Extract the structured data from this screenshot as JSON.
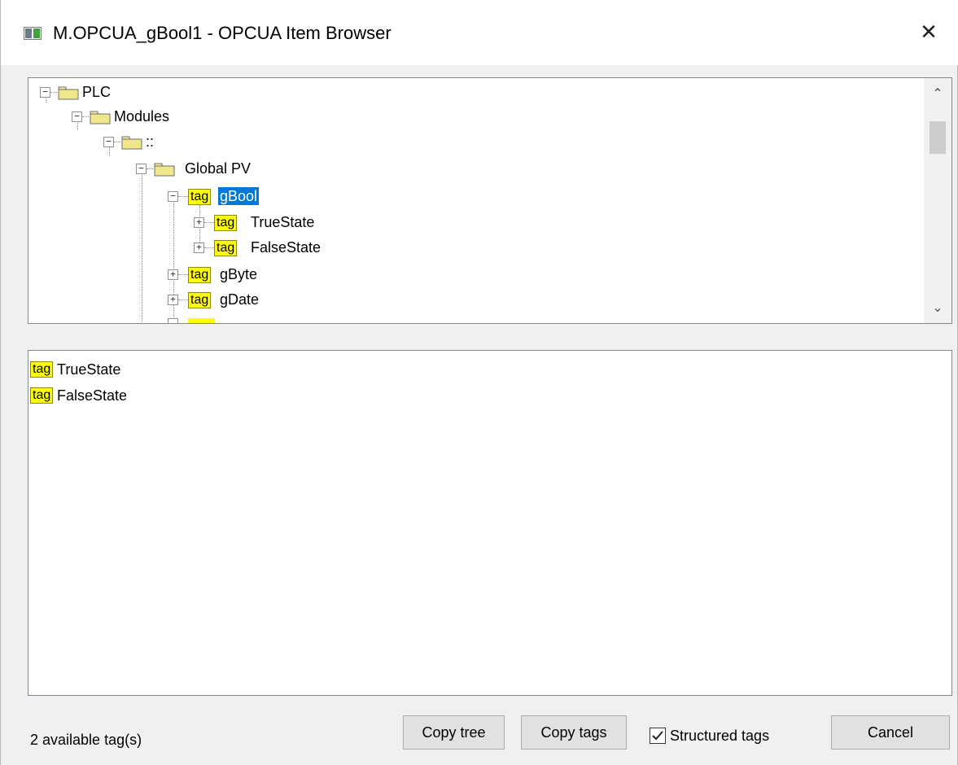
{
  "window": {
    "title": "M.OPCUA_gBool1 - OPCUA Item Browser",
    "close_glyph": "✕"
  },
  "tree": {
    "nodes": [
      {
        "label": "PLC",
        "icon": "folder-icon",
        "expander": "−"
      },
      {
        "label": "Modules",
        "icon": "folder-icon",
        "expander": "−"
      },
      {
        "label": "::",
        "icon": "folder-icon",
        "expander": "−"
      },
      {
        "label": "Global PV",
        "icon": "folder-icon",
        "expander": "−"
      },
      {
        "label": "gBool",
        "icon": "tag-icon",
        "expander": "−",
        "selected": true
      },
      {
        "label": "TrueState",
        "icon": "tag-icon",
        "expander": "+"
      },
      {
        "label": "FalseState",
        "icon": "tag-icon",
        "expander": "+"
      },
      {
        "label": "gByte",
        "icon": "tag-icon",
        "expander": "+"
      },
      {
        "label": "gDate",
        "icon": "tag-icon",
        "expander": "+"
      }
    ],
    "tag_icon_text": "tag",
    "scroll_up_glyph": "⌃",
    "scroll_down_glyph": "⌄"
  },
  "tag_list": {
    "items": [
      {
        "label": "TrueState",
        "icon_text": "tag"
      },
      {
        "label": "FalseState",
        "icon_text": "tag"
      }
    ]
  },
  "footer": {
    "status": "2 available tag(s)",
    "copy_tree_label": "Copy tree",
    "copy_tags_label": "Copy tags",
    "structured_tags_label": "Structured tags",
    "structured_tags_checked": true,
    "cancel_label": "Cancel"
  },
  "colors": {
    "selection": "#0078d7",
    "tag_bg": "#ffff00",
    "folder": "#f0e68c"
  }
}
